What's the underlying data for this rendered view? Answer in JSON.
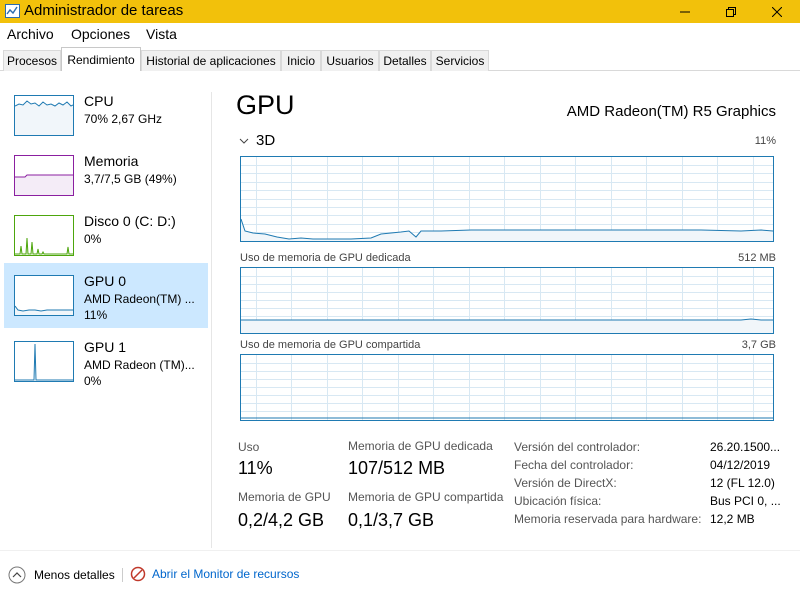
{
  "window": {
    "title": "Administrador de tareas",
    "controls": {
      "minimize": "minimize-icon",
      "maximize": "restore-icon",
      "close": "close-icon"
    }
  },
  "menu": [
    "Archivo",
    "Opciones",
    "Vista"
  ],
  "tabs": [
    {
      "label": "Procesos",
      "active": false
    },
    {
      "label": "Rendimiento",
      "active": true
    },
    {
      "label": "Historial de aplicaciones",
      "active": false
    },
    {
      "label": "Inicio",
      "active": false
    },
    {
      "label": "Usuarios",
      "active": false
    },
    {
      "label": "Detalles",
      "active": false
    },
    {
      "label": "Servicios",
      "active": false
    }
  ],
  "sidebar": {
    "items": [
      {
        "name": "CPU",
        "line1": "70% 2,67 GHz",
        "line2": "",
        "color": "#1f7ab2",
        "selected": false
      },
      {
        "name": "Memoria",
        "line1": "3,7/7,5 GB (49%)",
        "line2": "",
        "color": "#8b1fa0",
        "selected": false
      },
      {
        "name": "Disco 0 (C: D:)",
        "line1": "0%",
        "line2": "",
        "color": "#4da60c",
        "selected": false
      },
      {
        "name": "GPU 0",
        "line1": "AMD Radeon(TM) ...",
        "line2": "11%",
        "color": "#1f7ab2",
        "selected": true
      },
      {
        "name": "GPU 1",
        "line1": "AMD Radeon (TM)...",
        "line2": "0%",
        "color": "#1f7ab2",
        "selected": false
      }
    ]
  },
  "main": {
    "title": "GPU",
    "model": "AMD Radeon(TM) R5 Graphics",
    "engine": {
      "label": "3D",
      "percent": "11%"
    },
    "dedicated": {
      "label": "Uso de memoria de GPU dedicada",
      "max": "512 MB"
    },
    "shared": {
      "label": "Uso de memoria de GPU compartida",
      "max": "3,7 GB"
    },
    "colors": {
      "graph_line": "#1f7ab2",
      "graph_fill": "#f1f6fa",
      "grid": "#d8e8f3"
    }
  },
  "stats": {
    "usage": {
      "label": "Uso",
      "value": "11%"
    },
    "dedicated_mem": {
      "label": "Memoria de GPU dedicada",
      "value": "107/512 MB"
    },
    "gpu_mem": {
      "label": "Memoria de GPU",
      "value": "0,2/4,2 GB"
    },
    "shared_mem": {
      "label": "Memoria de GPU compartida",
      "value": "0,1/3,7 GB"
    }
  },
  "info": [
    {
      "label": "Versión del controlador:",
      "value": "26.20.1500..."
    },
    {
      "label": "Fecha del controlador:",
      "value": "04/12/2019"
    },
    {
      "label": "Versión de DirectX:",
      "value": "12 (FL 12.0)"
    },
    {
      "label": "Ubicación física:",
      "value": "Bus PCI 0, ..."
    },
    {
      "label": "Memoria reservada para hardware:",
      "value": "12,2 MB"
    }
  ],
  "bottom": {
    "fewer_details": "Menos detalles",
    "resource_monitor": "Abrir el Monitor de recursos"
  }
}
